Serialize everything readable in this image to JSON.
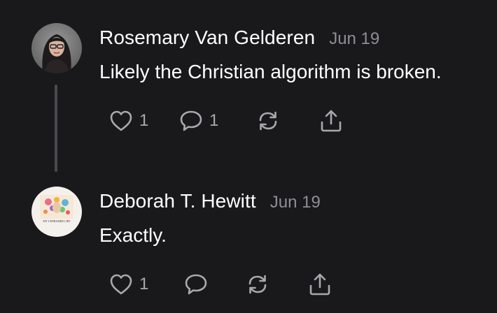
{
  "comments": [
    {
      "author": "Rosemary Van Gelderen",
      "date": "Jun 19",
      "text": "Likely the Christian algorithm is broken.",
      "likes": "1",
      "replies": "1",
      "avatar_icon": "user-photo-avatar"
    },
    {
      "author": "Deborah T. Hewitt",
      "date": "Jun 19",
      "text": "Exactly.",
      "likes": "1",
      "replies": "",
      "avatar_icon": "book-cover-avatar",
      "avatar_caption": "MY UNFRAMED LIFE"
    }
  ],
  "icons": {
    "like": "heart-icon",
    "reply": "comment-bubble-icon",
    "restack": "restack-arrows-icon",
    "share": "share-upload-icon"
  },
  "colors": {
    "background": "#19191b",
    "text": "#ffffff",
    "muted": "#8e8e93",
    "icon": "#a9a9ad",
    "thread_line": "#4a4a4d"
  }
}
